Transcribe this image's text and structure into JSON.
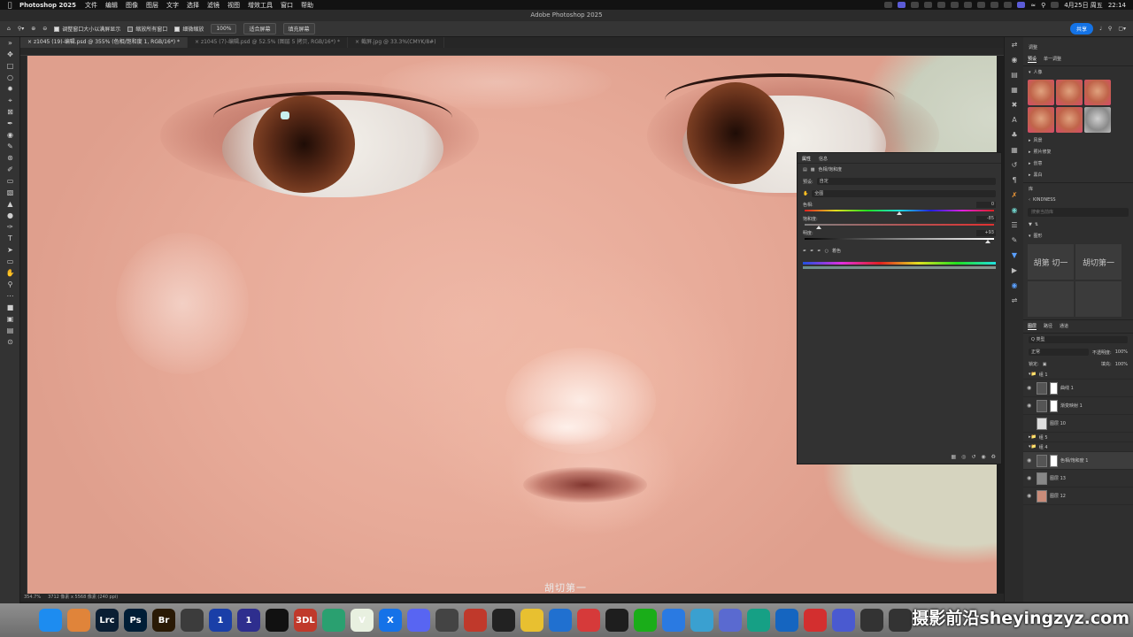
{
  "menubar": {
    "app": "Photoshop 2025",
    "items": [
      "文件",
      "编辑",
      "图像",
      "图层",
      "文字",
      "选择",
      "滤镜",
      "视图",
      "增效工具",
      "窗口",
      "帮助"
    ],
    "date": "4月25日 周五",
    "time": "22:14"
  },
  "window": {
    "title": "Adobe Photoshop 2025"
  },
  "options": {
    "resize_windows": "调整窗口大小以满屏显示",
    "zoom_all": "缩放所有窗口",
    "scrubby_zoom": "细微缩放",
    "zoom_pct": "100%",
    "fit_screen": "适合屏幕",
    "fill_screen": "填充屏幕",
    "share": "共享"
  },
  "tabs": [
    "z1045 (19)-编辑.psd @ 355% (色相/饱和度 1, RGB/16*) *",
    "z1045 (7)-编辑.psd @ 52.5% (图层 5 拷贝, RGB/16*) *",
    "截屏.jpg @ 33.3%(CMYK/8#)"
  ],
  "status": {
    "zoom": "354.7%",
    "doc": "3712 像素 x 5568 像素 (240 ppi)"
  },
  "canvas_watermark": "胡切第一",
  "properties": {
    "tab_properties": "属性",
    "tab_info": "信息",
    "adjust_name": "色相/饱和度",
    "preset_label": "预设:",
    "preset_value": "自定",
    "channel_value": "全图",
    "hue_label": "色相:",
    "hue_value": 0,
    "hue_display": "0",
    "sat_label": "饱和度:",
    "sat_value": -85,
    "sat_display": "-85",
    "light_label": "明度:",
    "light_value": 93,
    "light_display": "+93",
    "colorize": "着色"
  },
  "right": {
    "adjust_title": "调整",
    "tab_presets": "预设",
    "tab_single": "单一调整",
    "sec_portrait": "人像",
    "sec_landscape": "风景",
    "sec_photo_repair": "照片修复",
    "sec_creative": "创意",
    "sec_bw": "黑白",
    "library_title": "库",
    "library_name": "KINDNESS",
    "search_placeholder": "搜索当前库",
    "sec_graphics": "图形",
    "glyph_a": "胡第 切一",
    "glyph_b": "胡切第一",
    "layers_tabs": [
      "图层",
      "路径",
      "通道"
    ],
    "kind": "Q 类型",
    "blend": "正常",
    "opacity_label": "不透明度:",
    "opacity_value": "100%",
    "lock_label": "锁定:",
    "fill_label": "填充:",
    "fill_value": "100%",
    "layers": [
      {
        "name": "组 1",
        "type": "folder"
      },
      {
        "name": "曲线 1",
        "type": "adj"
      },
      {
        "name": "渐变映射 1",
        "type": "adj"
      },
      {
        "name": "图层 10",
        "type": "layer"
      },
      {
        "name": "组 5",
        "type": "folder"
      },
      {
        "name": "组 4",
        "type": "folder"
      },
      {
        "name": "色相/饱和度 1",
        "type": "adj",
        "selected": true
      },
      {
        "name": "图层 13",
        "type": "layer"
      },
      {
        "name": "图层 12",
        "type": "layer"
      }
    ]
  },
  "dock": [
    {
      "label": "",
      "icon": "finder-icon",
      "color": "#1d8cf0"
    },
    {
      "label": "",
      "icon": "launchpad-icon",
      "color": "#e0843a"
    },
    {
      "label": "Lrc",
      "icon": "lightroom-icon",
      "color": "#0a1e33"
    },
    {
      "label": "Ps",
      "icon": "photoshop-icon",
      "color": "#001e36"
    },
    {
      "label": "Br",
      "icon": "bridge-icon",
      "color": "#2a1a05"
    },
    {
      "label": "",
      "icon": "windows-icon",
      "color": "#3c3c3c"
    },
    {
      "label": "1",
      "icon": "onepassword-icon",
      "color": "#1a3fa8"
    },
    {
      "label": "1",
      "icon": "onepassword-alt-icon",
      "color": "#2e2e8e"
    },
    {
      "label": "",
      "icon": "capcut-icon",
      "color": "#111111"
    },
    {
      "label": "3DL",
      "icon": "3dlut-icon",
      "color": "#c0392b"
    },
    {
      "label": "",
      "icon": "settings-app-icon",
      "color": "#2aa070"
    },
    {
      "label": "V",
      "icon": "vectorize-icon",
      "color": "#e8f0e0"
    },
    {
      "label": "X",
      "icon": "xcode-icon",
      "color": "#1572e8"
    },
    {
      "label": "",
      "icon": "discord-icon",
      "color": "#5865f2"
    },
    {
      "label": "",
      "icon": "palette-icon",
      "color": "#444444"
    },
    {
      "label": "",
      "icon": "record-icon",
      "color": "#c0392b"
    },
    {
      "label": "",
      "icon": "speedtest-icon",
      "color": "#222222"
    },
    {
      "label": "",
      "icon": "chrome-icon",
      "color": "#e8c030"
    },
    {
      "label": "",
      "icon": "globe-icon",
      "color": "#2070d0"
    },
    {
      "label": "",
      "icon": "xiaohongshu-icon",
      "color": "#d63a3a"
    },
    {
      "label": "",
      "icon": "qq-icon",
      "color": "#1e1e1e"
    },
    {
      "label": "",
      "icon": "wechat-icon",
      "color": "#1aad19"
    },
    {
      "label": "",
      "icon": "baidu-netdisk-icon",
      "color": "#2a7ae2"
    },
    {
      "label": "",
      "icon": "bird-icon",
      "color": "#3aa0d0"
    },
    {
      "label": "",
      "icon": "play-icon",
      "color": "#5a6ad0"
    },
    {
      "label": "",
      "icon": "vim-icon",
      "color": "#16a085"
    },
    {
      "label": "",
      "icon": "navigate-icon",
      "color": "#1565c0"
    },
    {
      "label": "",
      "icon": "netease-music-icon",
      "color": "#d32f2f"
    },
    {
      "label": "",
      "icon": "cloud-icon",
      "color": "#4a5ad0"
    },
    {
      "label": "",
      "icon": "keyboard-icon",
      "color": "#333333"
    },
    {
      "label": "",
      "icon": "search-app-icon",
      "color": "#333333"
    }
  ],
  "watermark": "摄影前沿sheyingzyz.com"
}
